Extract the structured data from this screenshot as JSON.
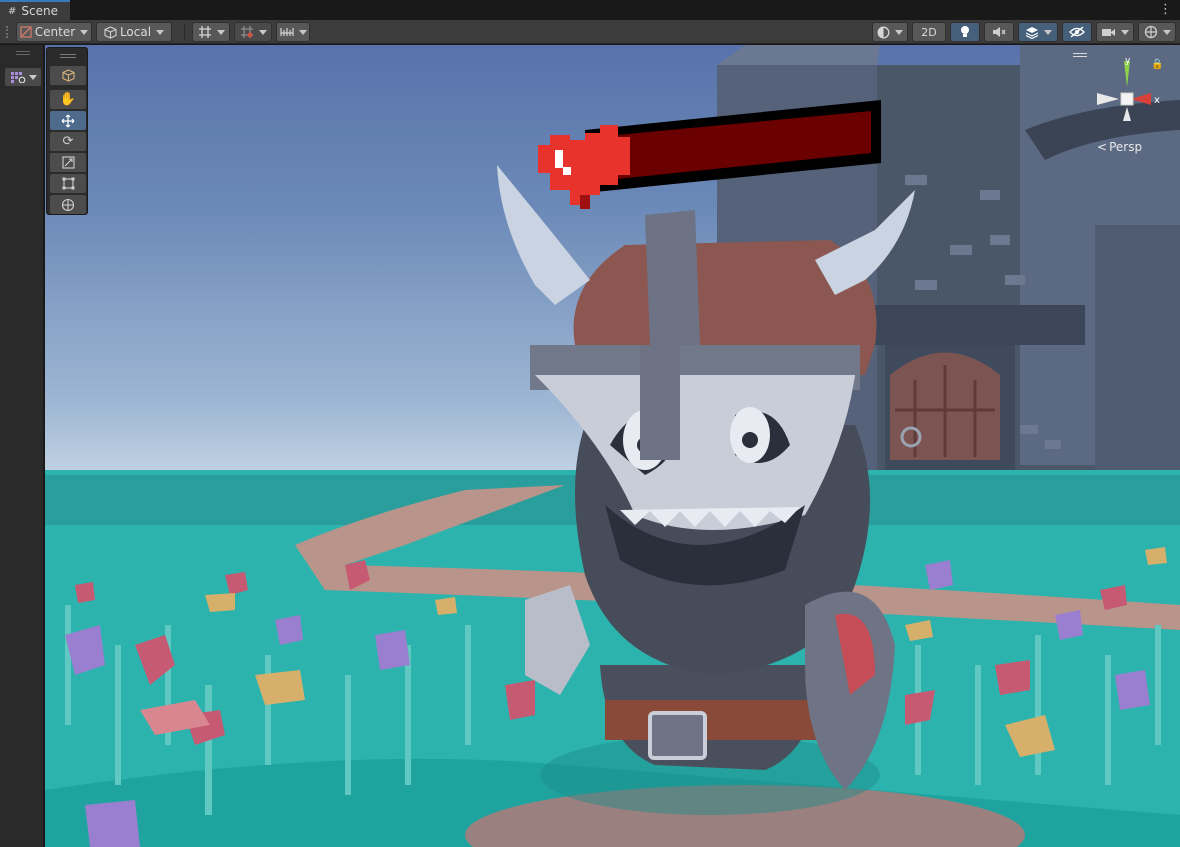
{
  "tab": {
    "label": "Scene"
  },
  "toolbar": {
    "pivot_label": "Center",
    "space_label": "Local",
    "mode_2d_label": "2D"
  },
  "gizmo": {
    "x_label": "x",
    "y_label": "y",
    "projection_label": "Persp"
  },
  "icons": {
    "scene_tab": "grid-icon",
    "more": "kebab-menu-icon",
    "pivot": "pivot-icon",
    "space": "cube-local-icon",
    "grid_snap": "grid-snap-icon",
    "increment_snap": "increment-snap-icon",
    "ruler": "ruler-icon",
    "draw_mode": "shading-mode-icon",
    "lighting": "lightbulb-icon",
    "audio": "audio-mute-icon",
    "effects": "effects-layers-icon",
    "visibility": "hidden-eye-icon",
    "camera": "camera-icon",
    "gizmos": "gizmos-icon",
    "lock": "lock-icon"
  },
  "scene": {
    "health_bar_fill": 0.0
  },
  "colors": {
    "accent": "#3a79bb",
    "active_tool": "#4e6a8c",
    "sky_top": "#5873ab",
    "grass": "#2fb3ae",
    "heart": "#e8332c",
    "bar_fill": "#6a0000"
  }
}
